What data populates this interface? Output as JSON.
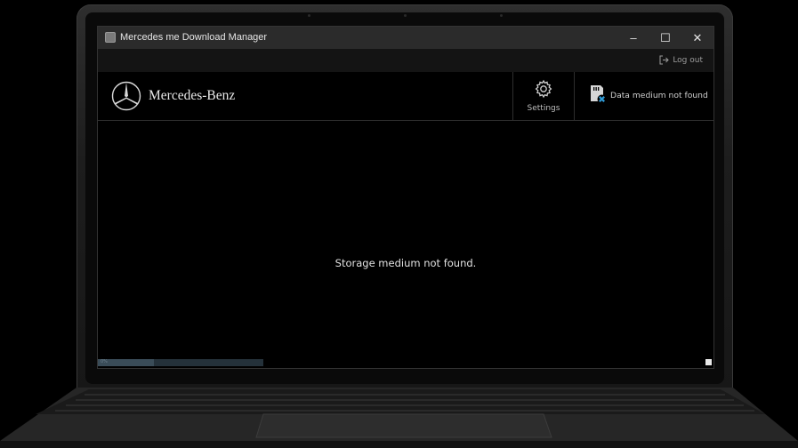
{
  "window": {
    "title": "Mercedes me Download Manager",
    "minimize_glyph": "–",
    "maximize_glyph": "☐",
    "close_glyph": "✕"
  },
  "subbar": {
    "logout_label": "Log out",
    "logout_icon": "logout-icon"
  },
  "header": {
    "brand_name": "Mercedes-Benz",
    "brand_icon": "mercedes-star-icon",
    "settings_label": "Settings",
    "settings_icon": "gear-icon",
    "medium_status_label": "Data medium not found",
    "medium_icon": "sd-card-error-icon"
  },
  "main": {
    "message": "Storage medium not found."
  },
  "statusbar": {
    "progress_fraction": 0.34,
    "progress_text": "0%"
  },
  "colors": {
    "background": "#000000",
    "titlebar": "#2b2b2b",
    "subbar": "#141414",
    "error_accent": "#2f9bd6"
  }
}
